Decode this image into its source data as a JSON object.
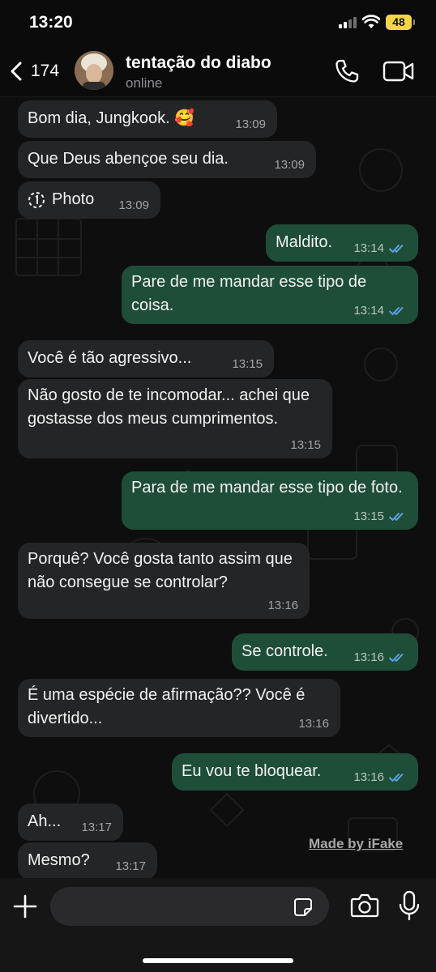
{
  "status_bar": {
    "time": "13:20",
    "battery": "48"
  },
  "header": {
    "back_count": "174",
    "contact_name": "tentação do diabo",
    "contact_status": "online"
  },
  "messages": [
    {
      "dir": "in",
      "text": "Bom dia, Jungkook. 🥰",
      "time": "13:09"
    },
    {
      "dir": "in",
      "text": "Que Deus abençoe seu dia.",
      "time": "13:09"
    },
    {
      "dir": "in",
      "text": "Photo",
      "time": "13:09",
      "icon": "view-once-icon"
    },
    {
      "dir": "out",
      "text": "Maldito.",
      "time": "13:14",
      "read": true
    },
    {
      "dir": "out",
      "text": "Pare de me mandar esse tipo de coisa.",
      "time": "13:14",
      "read": true
    },
    {
      "dir": "in",
      "text": "Você é tão agressivo...",
      "time": "13:15"
    },
    {
      "dir": "in",
      "text": "Não gosto de te incomodar... achei que gostasse dos meus cumprimentos.",
      "time": "13:15"
    },
    {
      "dir": "out",
      "text": "Para de me mandar esse tipo de foto.",
      "time": "13:15",
      "read": true
    },
    {
      "dir": "in",
      "text": "Porquê? Você gosta tanto assim que não consegue se controlar?",
      "time": "13:16"
    },
    {
      "dir": "out",
      "text": "Se controle.",
      "time": "13:16",
      "read": true
    },
    {
      "dir": "in",
      "text": "É uma espécie de afirmação?? Você é divertido...",
      "time": "13:16"
    },
    {
      "dir": "out",
      "text": "Eu vou te bloquear.",
      "time": "13:16",
      "read": true
    },
    {
      "dir": "in",
      "text": "Ah...",
      "time": "13:17"
    },
    {
      "dir": "in",
      "text": "Mesmo?",
      "time": "13:17"
    }
  ],
  "watermark": "Made by iFake",
  "input": {
    "placeholder": "",
    "value": ""
  },
  "colors": {
    "incoming_bubble": "#242526",
    "outgoing_bubble": "#1f4e38",
    "read_ticks": "#5aa9f5",
    "background": "#0b0b0b"
  },
  "icons": [
    "back-chevron-icon",
    "phone-icon",
    "video-camera-icon",
    "plus-icon",
    "sticker-icon",
    "camera-icon",
    "microphone-icon",
    "view-once-icon",
    "double-check-icon"
  ]
}
